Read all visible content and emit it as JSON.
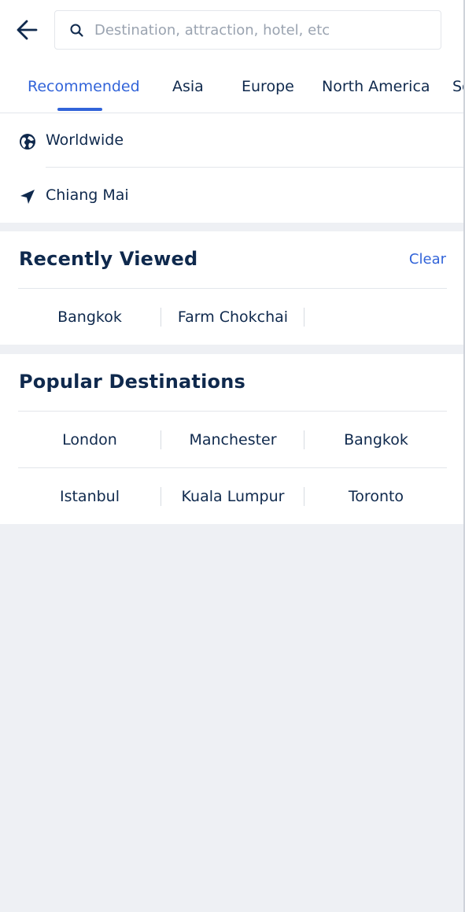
{
  "search": {
    "placeholder": "Destination, attraction, hotel, etc"
  },
  "tabs": [
    {
      "label": "Recommended",
      "active": true
    },
    {
      "label": "Asia"
    },
    {
      "label": "Europe"
    },
    {
      "label": "North America"
    },
    {
      "label": "South America"
    }
  ],
  "locations": [
    {
      "label": "Worldwide",
      "icon": "globe-icon"
    },
    {
      "label": "Chiang Mai",
      "icon": "location-arrow-icon"
    }
  ],
  "recently_viewed": {
    "title": "Recently Viewed",
    "clear_label": "Clear",
    "items": [
      "Bangkok",
      "Farm Chokchai"
    ]
  },
  "popular": {
    "title": "Popular Destinations",
    "items": [
      "London",
      "Manchester",
      "Bangkok",
      "Istanbul",
      "Kuala Lumpur",
      "Toronto"
    ]
  },
  "colors": {
    "accent": "#3264d9",
    "text": "#0f294d",
    "background": "#eef0f4"
  }
}
